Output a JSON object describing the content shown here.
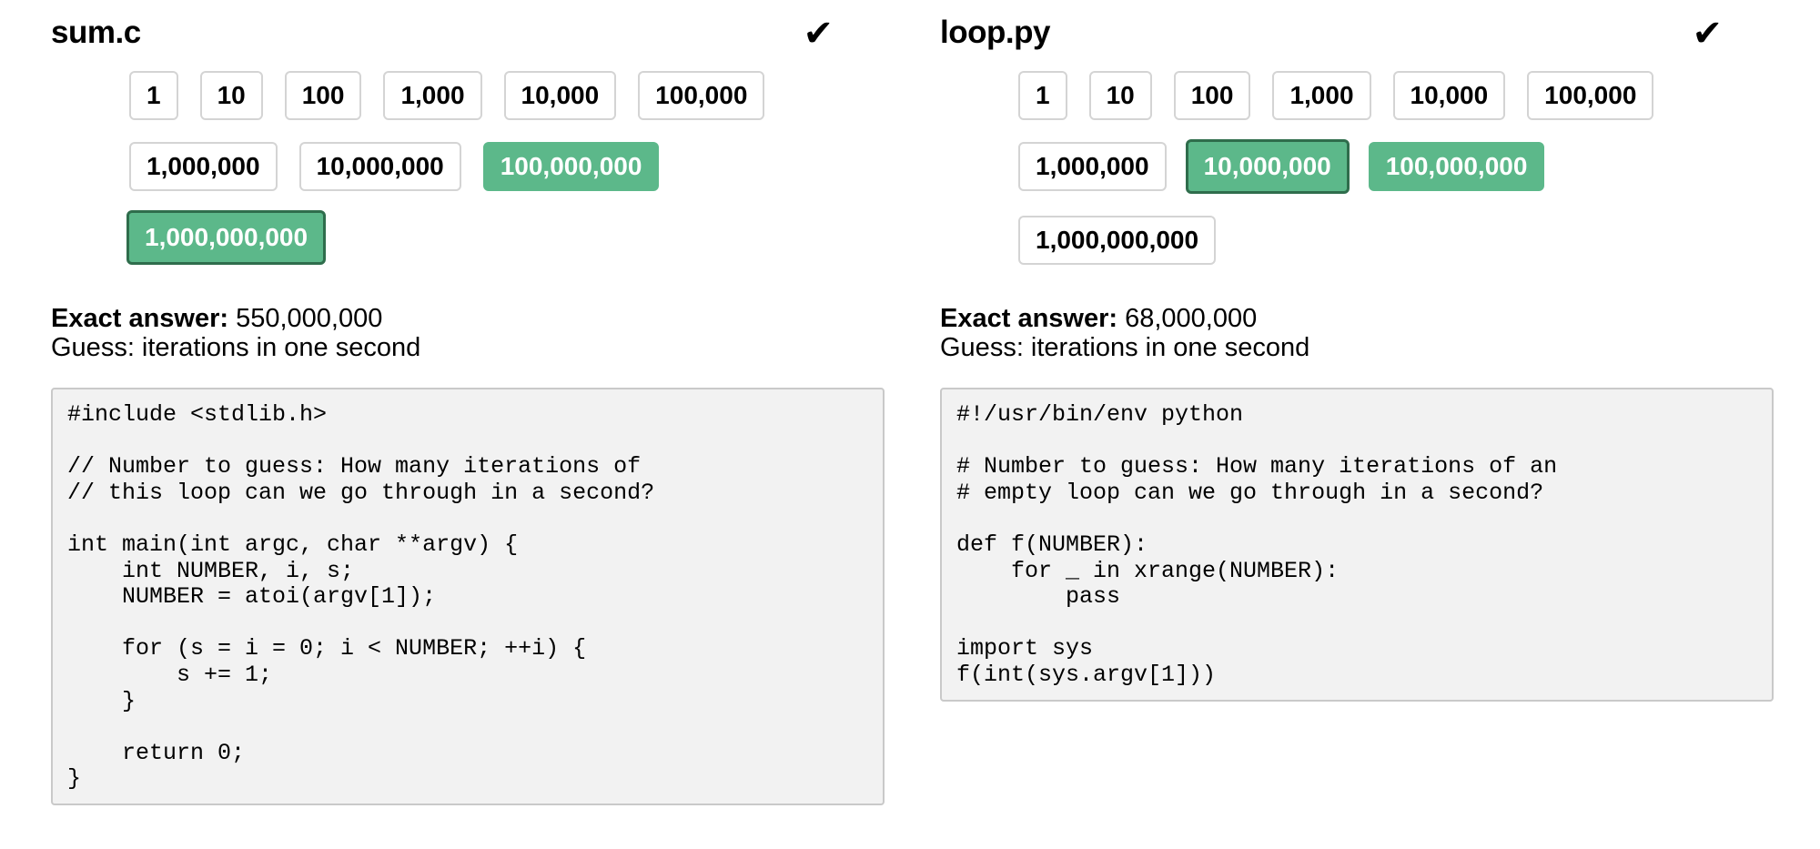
{
  "panels": [
    {
      "title": "sum.c",
      "status_icon": "check-icon",
      "check_glyph": "✔",
      "options": [
        {
          "label": "1",
          "selected": false
        },
        {
          "label": "10",
          "selected": false
        },
        {
          "label": "100",
          "selected": false
        },
        {
          "label": "1,000",
          "selected": false
        },
        {
          "label": "10,000",
          "selected": false
        },
        {
          "label": "100,000",
          "selected": false
        },
        {
          "label": "1,000,000",
          "selected": false
        },
        {
          "label": "10,000,000",
          "selected": false
        },
        {
          "label": "100,000,000",
          "selected": true,
          "active": false
        },
        {
          "label": "1,000,000,000",
          "selected": true,
          "active": true
        }
      ],
      "answer_label": "Exact answer:",
      "answer_value": "550,000,000",
      "guess_text": "Guess: iterations in one second",
      "code": "#include <stdlib.h>\n\n// Number to guess: How many iterations of\n// this loop can we go through in a second?\n\nint main(int argc, char **argv) {\n    int NUMBER, i, s;\n    NUMBER = atoi(argv[1]);\n\n    for (s = i = 0; i < NUMBER; ++i) {\n        s += 1;\n    }\n\n    return 0;\n}"
    },
    {
      "title": "loop.py",
      "status_icon": "check-icon",
      "check_glyph": "✔",
      "options": [
        {
          "label": "1",
          "selected": false
        },
        {
          "label": "10",
          "selected": false
        },
        {
          "label": "100",
          "selected": false
        },
        {
          "label": "1,000",
          "selected": false
        },
        {
          "label": "10,000",
          "selected": false
        },
        {
          "label": "100,000",
          "selected": false
        },
        {
          "label": "1,000,000",
          "selected": false
        },
        {
          "label": "10,000,000",
          "selected": true,
          "active": true
        },
        {
          "label": "100,000,000",
          "selected": true,
          "active": false
        },
        {
          "label": "1,000,000,000",
          "selected": false
        }
      ],
      "answer_label": "Exact answer:",
      "answer_value": "68,000,000",
      "guess_text": "Guess: iterations in one second",
      "code": "#!/usr/bin/env python\n\n# Number to guess: How many iterations of an\n# empty loop can we go through in a second?\n\ndef f(NUMBER):\n    for _ in xrange(NUMBER):\n        pass\n\nimport sys\nf(int(sys.argv[1]))"
    }
  ],
  "colors": {
    "selected_bg": "#5cb88a",
    "active_border": "#2f6d4c",
    "code_bg": "#f2f2f2"
  }
}
